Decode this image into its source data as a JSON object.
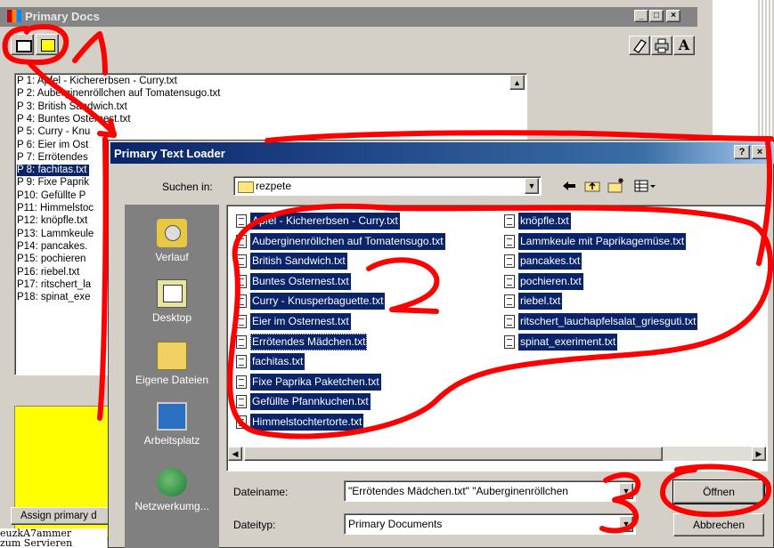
{
  "background_window": {
    "title": "Primary Docs",
    "controls": [
      "_",
      "□",
      "×"
    ],
    "tools": {
      "eraser": "eraser-icon",
      "print": "printer-icon",
      "font": "A"
    },
    "items": [
      "P 1: Apfel - Kichererbsen - Curry.txt",
      "P 2: Auberginenröllchen auf Tomatensugo.txt",
      "P 3: British Sandwich.txt",
      "P 4: Buntes Osternest.txt",
      "P 5: Curry - Knu",
      "P 6: Eier im Ost",
      "P 7: Errötendes",
      "P 8: fachitas.txt",
      "P 9: Fixe Paprik",
      "P10: Gefüllte P",
      "P11: Himmelstoc",
      "P12: knöpfle.txt",
      "P13: Lammkeule",
      "P14: pancakes.",
      "P15: pochieren",
      "P16: riebel.txt",
      "P17: ritschert_la",
      "P18: spinat_exe"
    ],
    "selected_index": 7,
    "assign_button": "Assign primary d",
    "lower_text": [
      "euzkA7ammer",
      "zum Servieren"
    ]
  },
  "dialog": {
    "title": "Primary Text Loader",
    "title_controls": [
      "?",
      "×"
    ],
    "look_in_label": "Suchen in:",
    "look_in_value": "rezpete",
    "places": [
      "Verlauf",
      "Desktop",
      "Eigene Dateien",
      "Arbeitsplatz",
      "Netzwerkumg..."
    ],
    "files_col1": [
      "Apfel - Kichererbsen - Curry.txt",
      "Auberginenröllchen auf Tomatensugo.txt",
      "British Sandwich.txt",
      "Buntes Osternest.txt",
      "Curry - Knusperbaguette.txt",
      "Eier im Osternest.txt",
      "Errötendes Mädchen.txt",
      "fachitas.txt",
      "Fixe Paprika Paketchen.txt",
      "Gefüllte Pfannkuchen.txt",
      "Himmelstochtertorte.txt"
    ],
    "files_col2": [
      "knöpfle.txt",
      "Lammkeule mit Paprikagemüse.txt",
      "pancakes.txt",
      "pochieren.txt",
      "riebel.txt",
      "ritschert_lauchapfelsalat_griesguti.txt",
      "spinat_exeriment.txt"
    ],
    "filename_label": "Dateiname:",
    "filename_value": "\"Errötendes Mädchen.txt\" \"Auberginenröllchen",
    "filetype_label": "Dateityp:",
    "filetype_value": "Primary Documents",
    "open_button": "Öffnen",
    "cancel_button": "Abbrechen"
  },
  "annotations": [
    "1",
    "2",
    "3"
  ],
  "colors": {
    "selection": "#0a246a",
    "annotation": "#ff0000",
    "face": "#d4d0c8"
  }
}
